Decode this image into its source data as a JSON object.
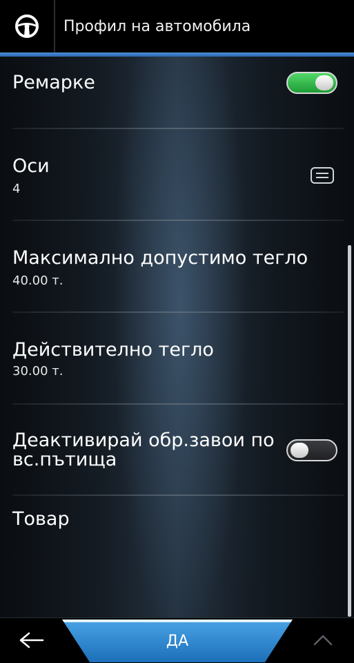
{
  "header": {
    "title": "Профил на автомобила",
    "icon": "steering-wheel-icon"
  },
  "settings": {
    "trailers": {
      "label": "Ремарке",
      "enabled": true
    },
    "axles": {
      "label": "Оси",
      "value": "4",
      "icon": "list-icon"
    },
    "max_weight": {
      "label": "Максимално допустимо тегло",
      "value": "40.00 т."
    },
    "actual_weight": {
      "label": "Действително тегло",
      "value": "30.00 т."
    },
    "u_turns": {
      "label": "Деактивирай обр.завои по вс.пътища",
      "enabled": false
    },
    "cargo": {
      "label": "Товар"
    }
  },
  "footer": {
    "back_icon": "arrow-left-icon",
    "ok_label": "ДА",
    "up_icon": "chevron-up-icon"
  },
  "colors": {
    "accent": "#2c66b0",
    "toggle_on": "#2ebd4a",
    "button": "#1c6fb8"
  }
}
